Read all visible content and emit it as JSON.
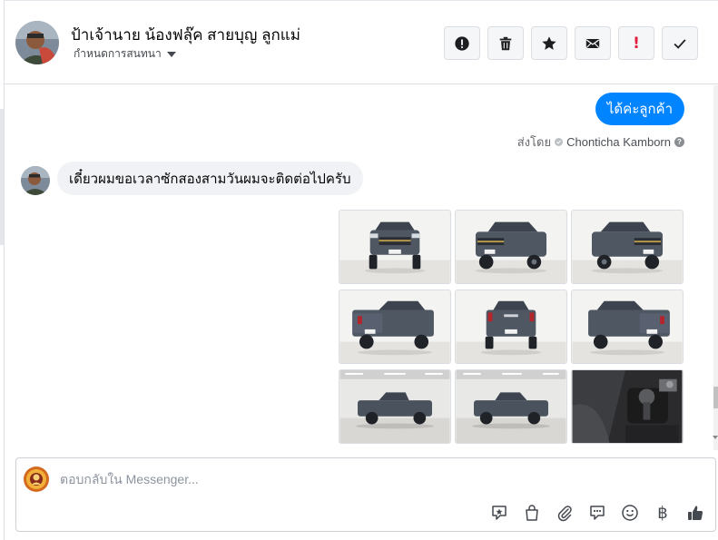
{
  "header": {
    "contact_name": "ป้าเจ้านาย น้องฟลุ๊ค สายบุญ ลูกแม่",
    "conversation_settings": "กำหนดการสนทนา",
    "toolbar": [
      {
        "icon": "alert-circle-icon"
      },
      {
        "icon": "trash-icon"
      },
      {
        "icon": "star-icon"
      },
      {
        "icon": "envelope-icon"
      },
      {
        "icon": "exclamation-icon",
        "label": "!"
      },
      {
        "icon": "checkmark-icon"
      }
    ]
  },
  "thread": {
    "outgoing_message": "ได้ค่ะลูกค้า",
    "sent_by_prefix": "ส่งโดย",
    "sent_by_name": "Chonticha Kamborn",
    "help_symbol": "?",
    "incoming_message": "เดี๋ยวผมขอเวลาซักสองสามวันผมจะติดต่อไปครับ",
    "photos": [
      {
        "view": "front"
      },
      {
        "view": "front-left"
      },
      {
        "view": "front-right"
      },
      {
        "view": "rear-left"
      },
      {
        "view": "rear"
      },
      {
        "view": "rear-right"
      },
      {
        "view": "side-left"
      },
      {
        "view": "side-left-far"
      },
      {
        "view": "interior-gear-shifter"
      }
    ]
  },
  "composer": {
    "placeholder": "ตอบกลับใน Messenger...",
    "tools": [
      "sticker-icon",
      "bag-icon",
      "paperclip-icon",
      "saved-reply-icon",
      "emoji-icon",
      "baht-icon",
      "thumbs-up-icon"
    ],
    "baht_symbol": "฿"
  },
  "colors": {
    "accent_blue": "#0084ff",
    "incoming_bubble": "#f0f2f5",
    "alert_red": "#e41e3f",
    "truck_body": "#4f5763"
  }
}
